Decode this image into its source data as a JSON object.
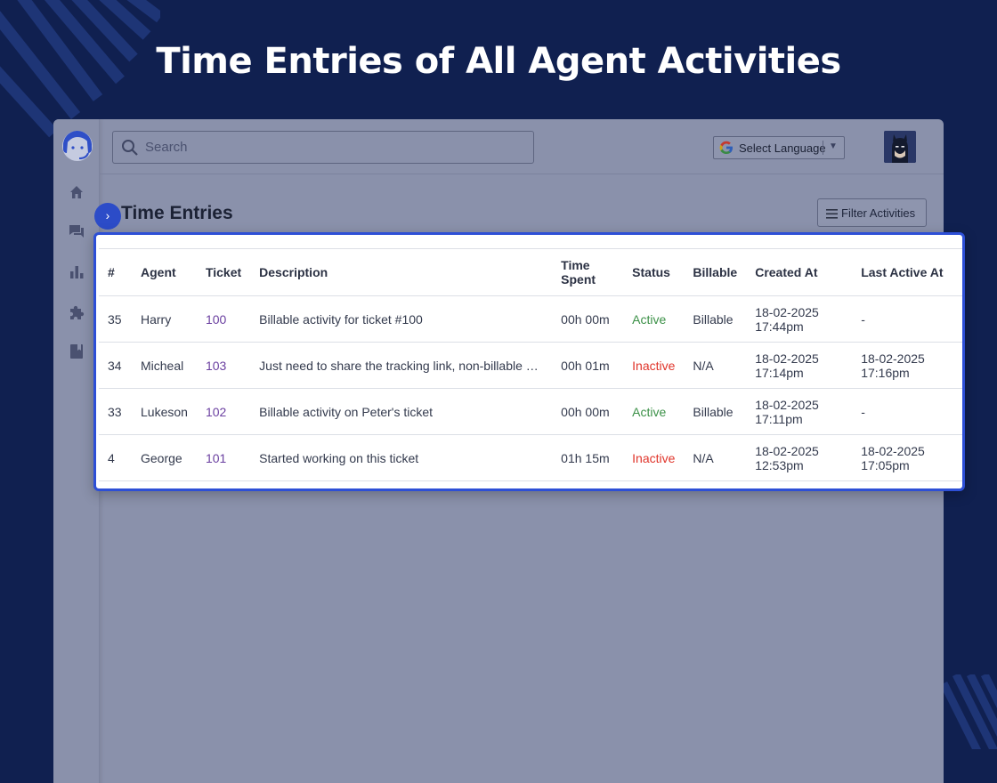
{
  "hero": {
    "title": "Time Entries of All Agent Activities"
  },
  "topbar": {
    "search_placeholder": "Search",
    "language_label": "Select Language",
    "language_caret": "▼"
  },
  "page": {
    "title": "Time Entries",
    "filter_label": "Filter Activities",
    "toggle_glyph": "›"
  },
  "table": {
    "headers": {
      "num": "#",
      "agent": "Agent",
      "ticket": "Ticket",
      "description": "Description",
      "time_spent_1": "Time",
      "time_spent_2": "Spent",
      "status": "Status",
      "billable": "Billable",
      "created_at": "Created At",
      "last_active_at": "Last Active At"
    },
    "rows": [
      {
        "num": "35",
        "agent": "Harry",
        "ticket": "100",
        "description": "Billable activity for ticket #100",
        "time_spent": "00h 00m",
        "status": "Active",
        "billable": "Billable",
        "created_date": "18-02-2025",
        "created_time": "17:44pm",
        "last_date": "-",
        "last_time": ""
      },
      {
        "num": "34",
        "agent": "Micheal",
        "ticket": "103",
        "description": "Just need to share the tracking link, non-billable …",
        "time_spent": "00h 01m",
        "status": "Inactive",
        "billable": "N/A",
        "created_date": "18-02-2025",
        "created_time": "17:14pm",
        "last_date": "18-02-2025",
        "last_time": "17:16pm"
      },
      {
        "num": "33",
        "agent": "Lukeson",
        "ticket": "102",
        "description": "Billable activity on Peter's ticket",
        "time_spent": "00h 00m",
        "status": "Active",
        "billable": "Billable",
        "created_date": "18-02-2025",
        "created_time": "17:11pm",
        "last_date": "-",
        "last_time": ""
      },
      {
        "num": "4",
        "agent": "George",
        "ticket": "101",
        "description": "Started working on this ticket",
        "time_spent": "01h 15m",
        "status": "Inactive",
        "billable": "N/A",
        "created_date": "18-02-2025",
        "created_time": "12:53pm",
        "last_date": "18-02-2025",
        "last_time": "17:05pm"
      }
    ]
  },
  "colors": {
    "background": "#102050",
    "accent": "#2d4fd6",
    "status_active": "#3c9148",
    "status_inactive": "#e0352b",
    "ticket_link": "#6a3fa0"
  },
  "icons": {
    "rail": [
      "home-icon",
      "conversations-icon",
      "reports-icon",
      "apps-icon",
      "knowledge-base-icon"
    ],
    "search": "search-icon",
    "language": "google-icon",
    "filter": "menu-lines-icon"
  }
}
